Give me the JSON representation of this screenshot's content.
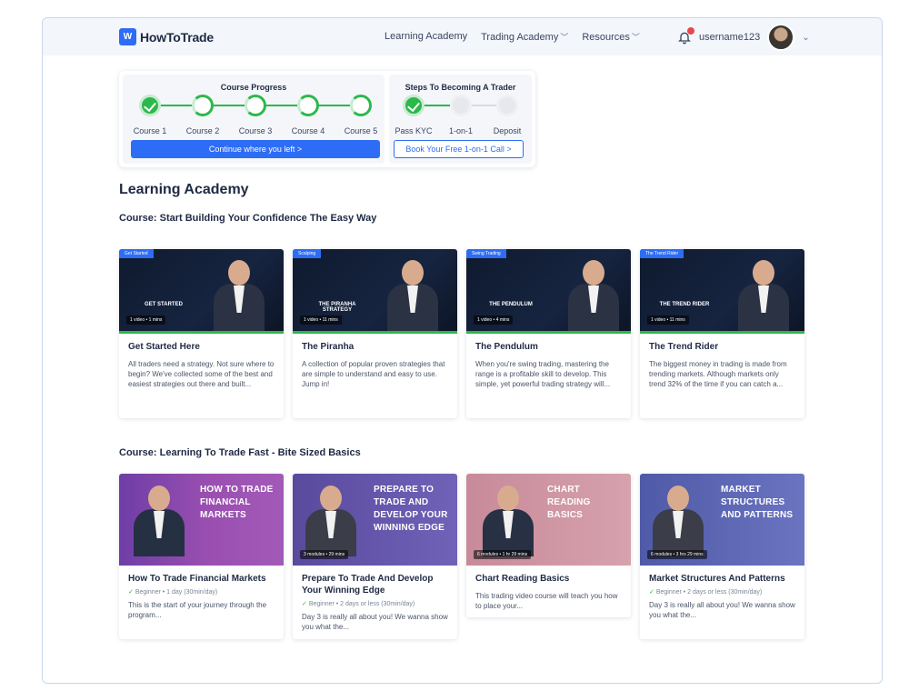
{
  "header": {
    "logo_mark": "W",
    "logo_text": "HowToTrade",
    "nav": [
      {
        "label": "Learning Academy",
        "dropdown": false
      },
      {
        "label": "Trading Academy",
        "dropdown": true
      },
      {
        "label": "Resources",
        "dropdown": true
      }
    ],
    "username": "username123",
    "icons": {
      "notifications": "bell-icon",
      "chevron": "chevron-down-icon"
    }
  },
  "progress": {
    "course_title": "Course Progress",
    "courses": [
      {
        "label": "Course 1",
        "state": "done"
      },
      {
        "label": "Course 2",
        "state": "in-progress"
      },
      {
        "label": "Course 3",
        "state": "in-progress"
      },
      {
        "label": "Course 4",
        "state": "in-progress"
      },
      {
        "label": "Course 5",
        "state": "in-progress"
      }
    ],
    "continue_label": "Continue where you left >",
    "steps_title": "Steps To Becoming A Trader",
    "steps": [
      {
        "label": "Pass KYC",
        "state": "done"
      },
      {
        "label": "1-on-1",
        "state": "todo"
      },
      {
        "label": "Deposit",
        "state": "todo"
      }
    ],
    "book_label": "Book Your Free 1-on-1 Call >"
  },
  "academy": {
    "title": "Learning Academy",
    "section1": {
      "title": "Course: Start Building Your Confidence The Easy Way",
      "cards": [
        {
          "tag": "Get Started",
          "art": "GET STARTED",
          "meta": "1 video • 1 mins",
          "title": "Get Started Here",
          "desc": "All traders need a strategy. Not sure where to begin? We've collected some of the best and easiest strategies out there and built..."
        },
        {
          "tag": "Scalping",
          "art": "THE PIRANHA STRATEGY",
          "meta": "1 video • 11 mins",
          "title": "The Piranha",
          "desc": "A collection of popular proven strategies that are simple to understand and easy to use. Jump in!"
        },
        {
          "tag": "Swing Trading",
          "art": "THE PENDULUM",
          "meta": "1 video • 4 mins",
          "title": "The Pendulum",
          "desc": "When you're swing trading, mastering the range is a profitable skill to develop. This simple, yet powerful trading strategy will..."
        },
        {
          "tag": "The Trend Rider",
          "art": "THE TREND RIDER",
          "meta": "1 video • 11 mins",
          "title": "The Trend Rider",
          "desc": "The biggest money in trading is made from trending markets. Although markets only trend 32% of the time if you can catch a..."
        }
      ]
    },
    "section2": {
      "title": "Course: Learning To Trade Fast - Bite Sized Basics",
      "cards": [
        {
          "hero": "HOW TO TRADE FINANCIAL MARKETS",
          "meta": "",
          "title": "How To Trade Financial Markets",
          "level": "Beginner • 1 day (30min/day)",
          "desc": "This is the start of your journey through the program..."
        },
        {
          "hero": "PREPARE TO TRADE AND DEVELOP YOUR WINNING EDGE",
          "meta": "3 modules • 29 mins",
          "title": "Prepare To Trade And Develop Your Winning Edge",
          "level": "Beginner • 2 days or less (30min/day)",
          "desc": "Day 3 is really all about you! We wanna show you what the..."
        },
        {
          "hero": "CHART READING BASICS",
          "meta": "6 modules • 1 hr 29 mins",
          "title": "Chart Reading Basics",
          "level": "",
          "desc": "This trading video course will teach you how to place your..."
        },
        {
          "hero": "MARKET STRUCTURES AND PATTERNS",
          "meta": "6 modules • 3 hrs 29 mins",
          "title": "Market Structures And Patterns",
          "level": "Beginner • 2 days or less (30min/day)",
          "desc": "Day 3 is really all about you! We wanna show you what the..."
        }
      ]
    }
  },
  "colors": {
    "accent": "#2d6df6",
    "success": "#2db84b",
    "text": "#1f2a44"
  }
}
